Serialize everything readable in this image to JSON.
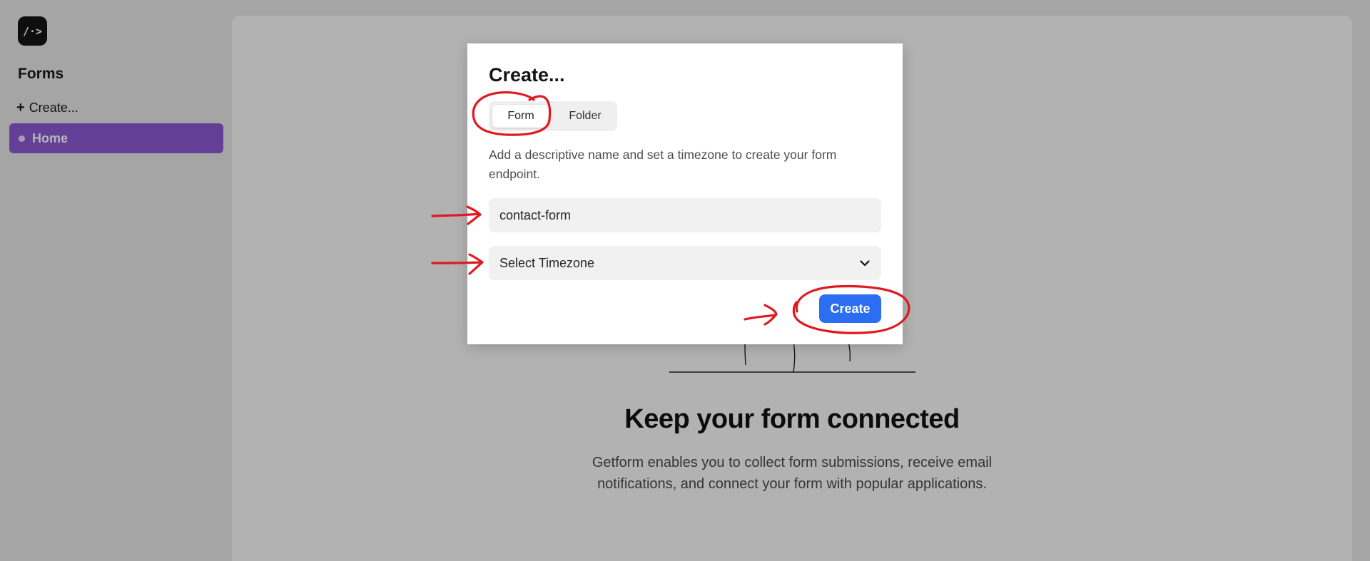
{
  "app": {
    "logo_text": "/·>",
    "logo_icon": "getform-logo-icon"
  },
  "sidebar": {
    "title": "Forms",
    "create_label": "Create...",
    "create_icon": "plus-icon",
    "items": [
      {
        "label": "Home",
        "active": true,
        "icon": "dot-icon"
      }
    ],
    "active_color": "#8c5ad6"
  },
  "main": {
    "hero_title": "Keep your form connected",
    "hero_text": "Getform enables you to collect form submissions, receive email notifications, and connect your form with popular applications."
  },
  "modal": {
    "title": "Create...",
    "tabs": [
      {
        "label": "Form",
        "selected": true
      },
      {
        "label": "Folder",
        "selected": false
      }
    ],
    "description": "Add a descriptive name and set a timezone to create your form endpoint.",
    "name_value": "contact-form",
    "timezone_placeholder": "Select Timezone",
    "timezone_icon": "chevron-down-icon",
    "create_button": "Create",
    "button_color": "#2b6ef2"
  },
  "annotations": {
    "color": "#e0191f",
    "marks": [
      "circle-form-tab",
      "arrow-name-field",
      "arrow-timezone-field",
      "arrow-create-button",
      "circle-create-button"
    ]
  }
}
